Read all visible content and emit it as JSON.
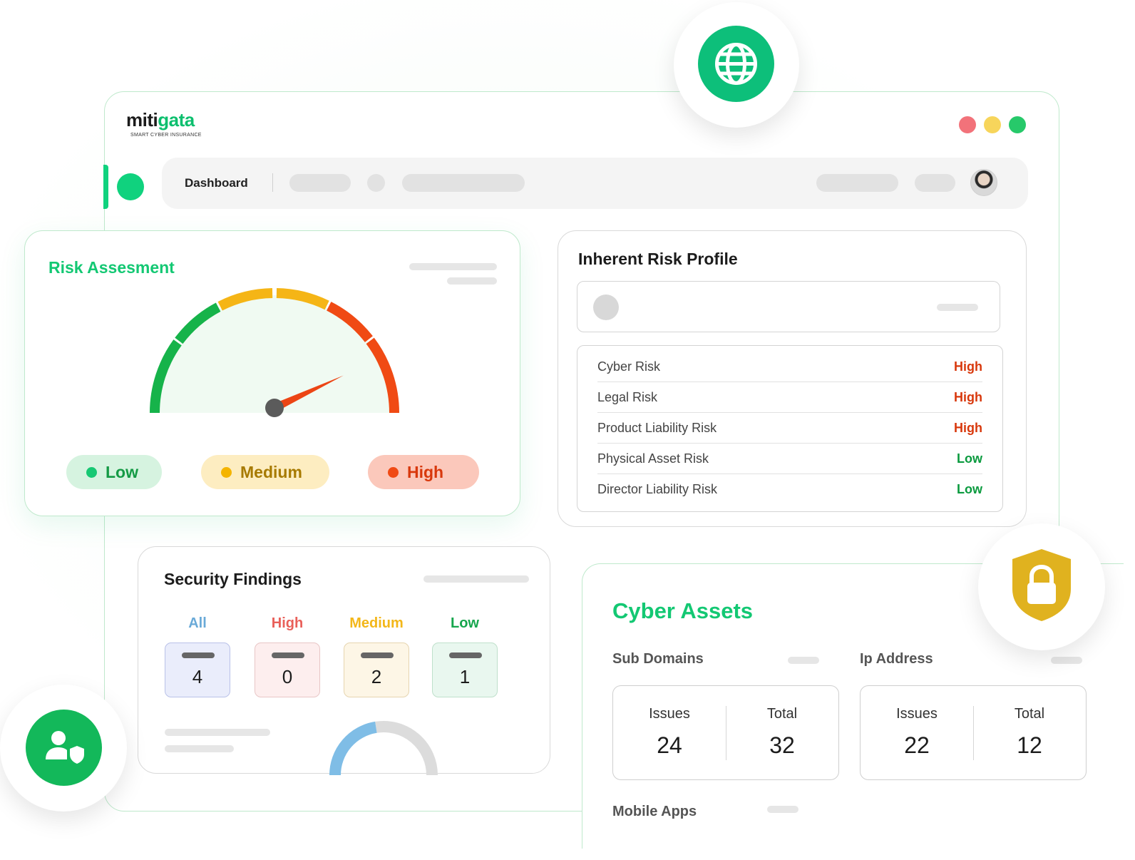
{
  "app": {
    "brand_prefix": "miti",
    "brand_suffix": "gata",
    "brand_tagline": "SMART CYBER INSURANCE"
  },
  "nav": {
    "dashboard_label": "Dashboard"
  },
  "colors": {
    "brand_green": "#13c873",
    "traffic_red": "#f2727a",
    "traffic_yellow": "#f7d55b",
    "traffic_green": "#27c96a",
    "risk_high": "#d8380c",
    "risk_low": "#0a9a3e"
  },
  "icons": {
    "globe": "globe-icon",
    "shield_lock": "shield-lock-icon",
    "user_shield": "user-shield-icon"
  },
  "risk_assessment": {
    "title": "Risk Assesment",
    "legend": [
      {
        "label": "Low",
        "color": "#17c873",
        "bg": "#d6f3e0",
        "text": "#149a45"
      },
      {
        "label": "Medium",
        "color": "#f4b400",
        "bg": "#fdedc1",
        "text": "#a77a00"
      },
      {
        "label": "High",
        "color": "#f04a14",
        "bg": "#fbc8bb",
        "text": "#d8380c"
      }
    ],
    "gauge_level": 0.86
  },
  "inherent_risk_profile": {
    "title": "Inherent Risk Profile",
    "rows": [
      {
        "label": "Cyber Risk",
        "value": "High"
      },
      {
        "label": "Legal Risk",
        "value": "High"
      },
      {
        "label": "Product Liability Risk",
        "value": "High"
      },
      {
        "label": "Physical Asset Risk",
        "value": "Low"
      },
      {
        "label": "Director Liability Risk",
        "value": "Low"
      }
    ]
  },
  "security_findings": {
    "title": "Security Findings",
    "categories": [
      {
        "label": "All",
        "count": "4",
        "label_color": "#6aaad8",
        "bg": "#eaedfb",
        "border": "#b9c1e8"
      },
      {
        "label": "High",
        "count": "0",
        "label_color": "#e9605a",
        "bg": "#fdeeee",
        "border": "#e8c6c6"
      },
      {
        "label": "Medium",
        "count": "2",
        "label_color": "#f3b71a",
        "bg": "#fdf6e6",
        "border": "#e6d5b0"
      },
      {
        "label": "Low",
        "count": "1",
        "label_color": "#16a64d",
        "bg": "#e9f7ef",
        "border": "#bfe0cb"
      }
    ],
    "donut_fraction": 0.45
  },
  "cyber_assets": {
    "title": "Cyber Assets",
    "sub_domains": {
      "label": "Sub Domains",
      "issues_label": "Issues",
      "issues": "24",
      "total_label": "Total",
      "total": "32"
    },
    "ip_address": {
      "label": "Ip Address",
      "issues_label": "Issues",
      "issues": "22",
      "total_label": "Total",
      "total": "12"
    },
    "mobile_apps": {
      "label": "Mobile Apps"
    }
  }
}
